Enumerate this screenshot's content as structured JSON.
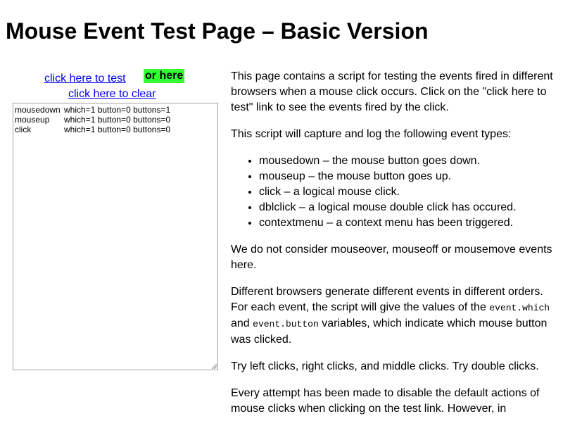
{
  "page": {
    "title": "Mouse Event Test Page – Basic Version"
  },
  "controls": {
    "test_link": "click here to test",
    "or_here": "or here",
    "clear_link": "click here to clear"
  },
  "log": {
    "lines": [
      {
        "event": "mousedown",
        "detail": "which=1 button=0 buttons=1"
      },
      {
        "event": "mouseup",
        "detail": "which=1 button=0 buttons=0"
      },
      {
        "event": "click",
        "detail": "which=1 button=0 buttons=0"
      }
    ]
  },
  "content": {
    "intro": "This page contains a script for testing the events fired in different browsers when a mouse click occurs. Click on the \"click here to test\" link to see the events fired by the click.",
    "capture_intro": "This script will capture and log the following event types:",
    "event_types": [
      "mousedown – the mouse button goes down.",
      "mouseup – the mouse button goes up.",
      "click – a logical mouse click.",
      "dblclick – a logical mouse double click has occured.",
      "contextmenu – a context menu has been triggered."
    ],
    "not_considered": "We do not consider mouseover, mouseoff or mousemove events here.",
    "diff_part1": "Different browsers generate different events in different orders. For each event, the script will give the values of the ",
    "code_which": "event.which",
    "diff_and": " and ",
    "code_button": "event.button",
    "diff_part2": " variables, which indicate which mouse button was clicked.",
    "try_clicks": "Try left clicks, right clicks, and middle clicks. Try double clicks.",
    "every_attempt": "Every attempt has been made to disable the default actions of mouse clicks when clicking on the test link. However, in"
  }
}
